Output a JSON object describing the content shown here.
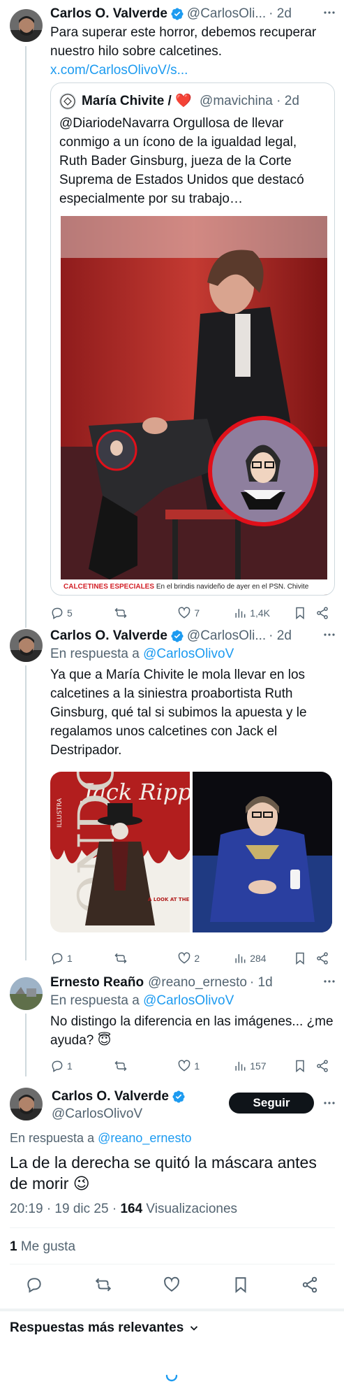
{
  "tweet1": {
    "name": "Carlos O. Valverde",
    "handle": "@CarlosOli...",
    "time": "· 2d",
    "text": "Para superar este horror, debemos recuperar nuestro hilo sobre calcetines.",
    "link": "x.com/CarlosOlivoV/s...",
    "quote": {
      "name": "María Chivite / ❤️",
      "handle": "@mavichina",
      "time": "· 2d",
      "text": "@DiariodeNavarra Orgullosa de llevar conmigo a un ícono de la igualdad legal, Ruth Bader Ginsburg, jueza de la Corte Suprema de Estados Unidos que destacó especialmente por su trabajo…",
      "caption_bold": "CALCETINES ESPECIALES",
      "caption_rest": "En el brindis navideño de ayer en el PSN. Chivite"
    },
    "replies": "5",
    "retweets": "",
    "likes": "7",
    "views": "1,4K"
  },
  "tweet2": {
    "name": "Carlos O. Valverde",
    "handle": "@CarlosOli...",
    "time": "· 2d",
    "reply_label": "En respuesta a",
    "reply_handle": "@CarlosOlivoV",
    "text": "Ya que a María Chivite le mola llevar en los calcetines a la siniestra proabortista Ruth Ginsburg, qué tal si subimos la apuesta y le regalamos unos calcetines con Jack el Destripador.",
    "comic_title": "Jack Ripper",
    "comic_vertical": "ILLUSTRA",
    "comic_big": "ONDO",
    "comic_tag": "A LOOK AT THE MOST INFAMOUS KILLER OF ALL TIME",
    "replies": "1",
    "likes": "2",
    "views": "284"
  },
  "tweet3": {
    "name": "Ernesto Reaño",
    "handle": "@reano_ernesto",
    "time": "· 1d",
    "reply_label": "En respuesta a",
    "reply_handle": "@CarlosOlivoV",
    "text": "No distingo la diferencia en las imágenes... ¿me ayuda? 😇",
    "replies": "1",
    "likes": "1",
    "views": "157"
  },
  "main": {
    "name": "Carlos O. Valverde",
    "handle": "@CarlosOlivoV",
    "follow": "Seguir",
    "reply_label": "En respuesta a",
    "reply_handle": "@reano_ernesto",
    "text": "La de la derecha se quitó la máscara antes de morir 😉",
    "timestamp": "20:19 · 19 dic 25 · ",
    "views_count": "164",
    "views_label": " Visualizaciones",
    "likes_count": "1",
    "likes_label": " Me gusta"
  },
  "sort_label": "Respuestas más relevantes",
  "colors": {
    "accent": "#1d9bf0",
    "secondary": "#536471",
    "border": "#cfd9de"
  }
}
